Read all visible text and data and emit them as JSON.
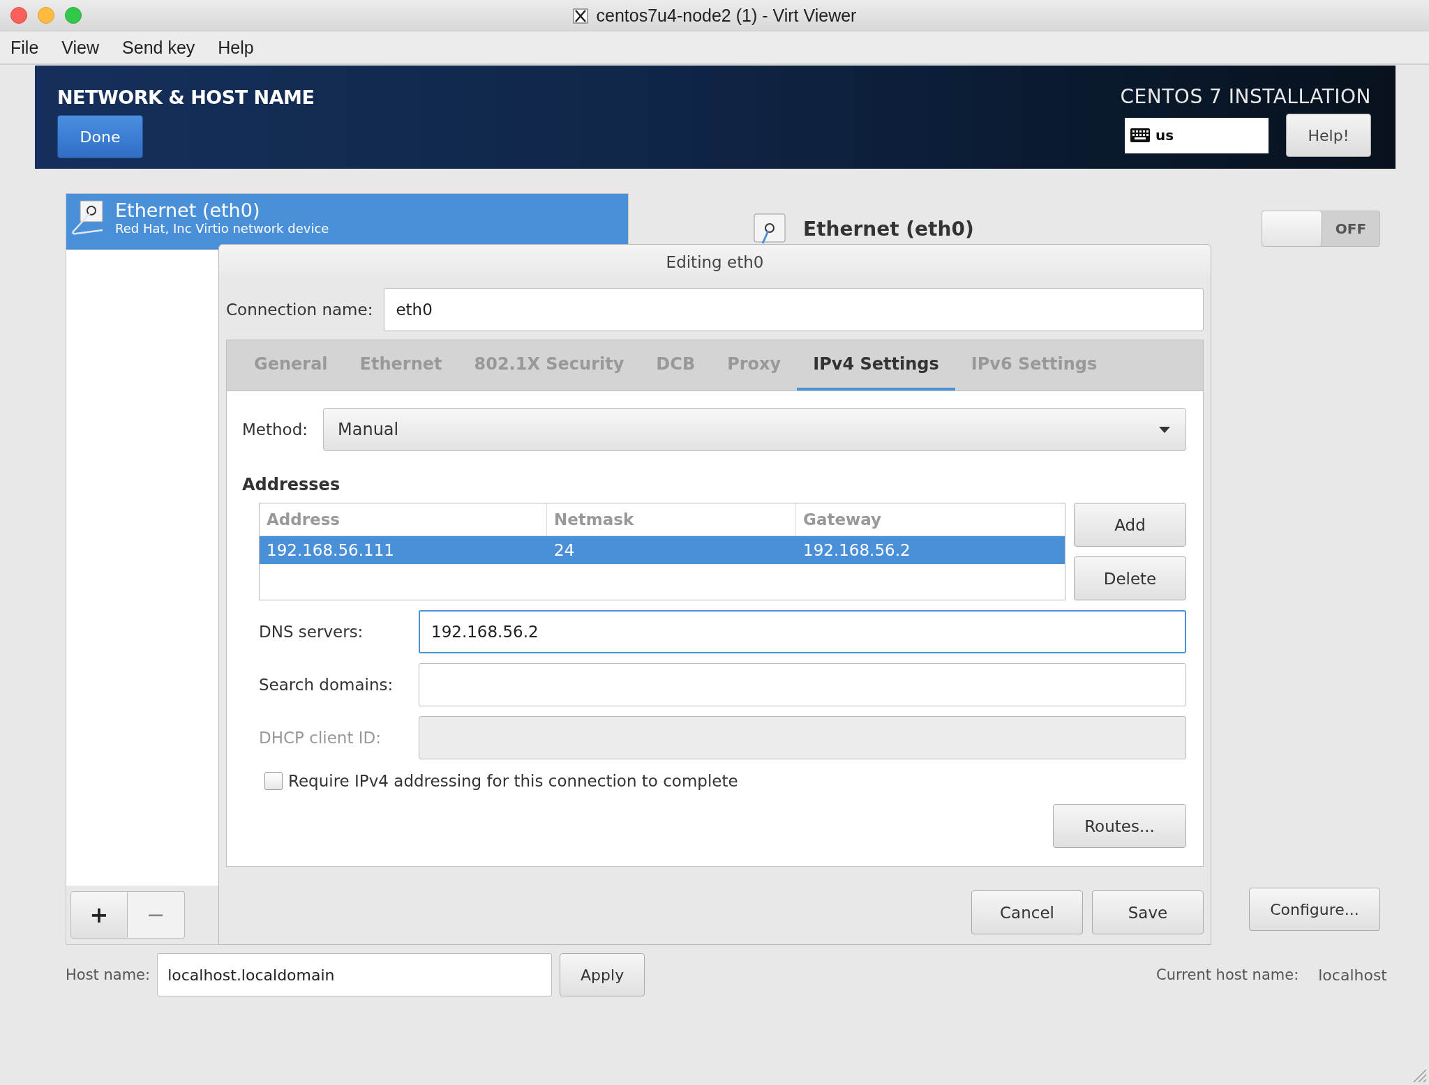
{
  "window": {
    "title": "centos7u4-node2 (1) - Virt Viewer"
  },
  "menu": [
    "File",
    "View",
    "Send key",
    "Help"
  ],
  "header": {
    "title": "NETWORK & HOST NAME",
    "done": "Done",
    "product": "CENTOS 7 INSTALLATION",
    "keyboard": "us",
    "help": "Help!"
  },
  "devices": [
    {
      "name": "Ethernet (eth0)",
      "description": "Red Hat, Inc Virtio network device",
      "selected": true
    }
  ],
  "device_buttons": [
    "+",
    "−"
  ],
  "device_detail": {
    "name": "Ethernet (eth0)",
    "toggle": {
      "label": "OFF",
      "on": false
    },
    "configure": "Configure..."
  },
  "dialog": {
    "title": "Editing eth0",
    "connection_name": {
      "label": "Connection name:",
      "value": "eth0"
    },
    "tabs": [
      {
        "label": "General",
        "selected": false
      },
      {
        "label": "Ethernet",
        "selected": false
      },
      {
        "label": "802.1X Security",
        "selected": false
      },
      {
        "label": "DCB",
        "selected": false
      },
      {
        "label": "Proxy",
        "selected": false
      },
      {
        "label": "IPv4 Settings",
        "selected": true
      },
      {
        "label": "IPv6 Settings",
        "selected": false
      }
    ],
    "method": {
      "label": "Method:",
      "value": "Manual"
    },
    "addresses": {
      "title": "Addresses",
      "columns": [
        "Address",
        "Netmask",
        "Gateway"
      ],
      "rows": [
        {
          "cells": [
            "192.168.56.111",
            "24",
            "192.168.56.2"
          ],
          "selected": true
        }
      ],
      "buttons": [
        "Add",
        "Delete"
      ]
    },
    "fields": [
      {
        "label": "DNS servers:",
        "value": "192.168.56.2",
        "focused": true,
        "disabled": false
      },
      {
        "label": "Search domains:",
        "focused": false,
        "disabled": false
      },
      {
        "label": "DHCP client ID:",
        "focused": false,
        "disabled": true
      }
    ],
    "require": {
      "label": "Require IPv4 addressing for this connection to complete",
      "checked": false
    },
    "routes": "Routes...",
    "buttons": [
      "Cancel",
      "Save"
    ]
  },
  "hostname": {
    "label": "Host name:",
    "value": "localhost.localdomain",
    "apply": "Apply",
    "current_label": "Current host name:",
    "current_value": "localhost"
  }
}
